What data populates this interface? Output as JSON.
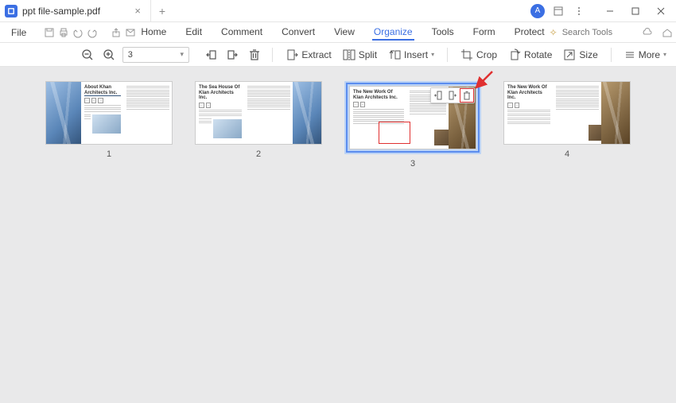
{
  "titlebar": {
    "tab_title": "ppt file-sample.pdf",
    "avatar_initial": "A"
  },
  "menubar": {
    "file": "File",
    "items": [
      "Home",
      "Edit",
      "Comment",
      "Convert",
      "View",
      "Organize",
      "Tools",
      "Form",
      "Protect"
    ],
    "active_index": 5,
    "search_placeholder": "Search Tools"
  },
  "toolbar": {
    "page_value": "3",
    "extract": "Extract",
    "split": "Split",
    "insert": "Insert",
    "crop": "Crop",
    "rotate": "Rotate",
    "size": "Size",
    "more": "More"
  },
  "pages": [
    {
      "num": "1",
      "title": "About Khan Architects Inc."
    },
    {
      "num": "2",
      "title": "The Sea House Of Klan Architects Inc."
    },
    {
      "num": "3",
      "title": "The New Work Of Klan Architects Inc.",
      "selected": true
    },
    {
      "num": "4",
      "title": "The New Work Of Klan Architects Inc."
    }
  ],
  "float_controls": [
    "insert-left",
    "insert-right",
    "delete"
  ],
  "colors": {
    "accent": "#3b6fe3",
    "highlight": "#e03030",
    "selection": "#bcd3f5"
  }
}
